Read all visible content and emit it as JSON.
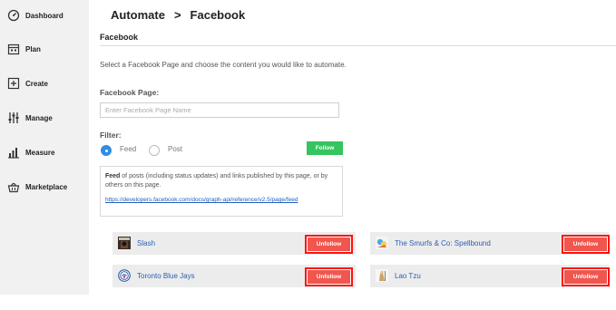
{
  "sidebar": {
    "items": [
      {
        "label": "Dashboard",
        "icon": "dashboard-icon"
      },
      {
        "label": "Plan",
        "icon": "calendar-icon"
      },
      {
        "label": "Create",
        "icon": "plus-square-icon"
      },
      {
        "label": "Manage",
        "icon": "sliders-icon"
      },
      {
        "label": "Measure",
        "icon": "bar-chart-icon"
      },
      {
        "label": "Marketplace",
        "icon": "basket-icon"
      }
    ]
  },
  "header": {
    "crumb_parent": "Automate",
    "crumb_separator": ">",
    "crumb_current": "Facebook"
  },
  "section": {
    "title": "Facebook",
    "intro": "Select a Facebook Page and choose the content you would like to automate."
  },
  "form": {
    "page_label": "Facebook Page:",
    "page_placeholder": "Enter Facebook Page Name",
    "page_value": "",
    "filter_label": "Filter:",
    "filter_options": [
      "Feed",
      "Post"
    ],
    "filter_selected": "Feed",
    "follow_label": "Follow"
  },
  "info": {
    "term": "Feed",
    "description": " of posts (including status updates) and links published by this page, or by others on this page.",
    "link": "https://developers.facebook.com/docs/graph-api/reference/v2.5/page/feed"
  },
  "followed_pages": [
    {
      "name": "Slash",
      "action": "Unfollow"
    },
    {
      "name": "The Smurfs & Co: Spellbound",
      "action": "Unfollow"
    },
    {
      "name": "Toronto Blue Jays",
      "action": "Unfollow"
    },
    {
      "name": "Lao Tzu",
      "action": "Unfollow"
    }
  ],
  "colors": {
    "follow_green": "#34c55e",
    "unfollow_red": "#f0564d",
    "highlight_border": "#ff1010",
    "radio_blue": "#2f8ee6",
    "link_blue": "#2b5fb3"
  }
}
